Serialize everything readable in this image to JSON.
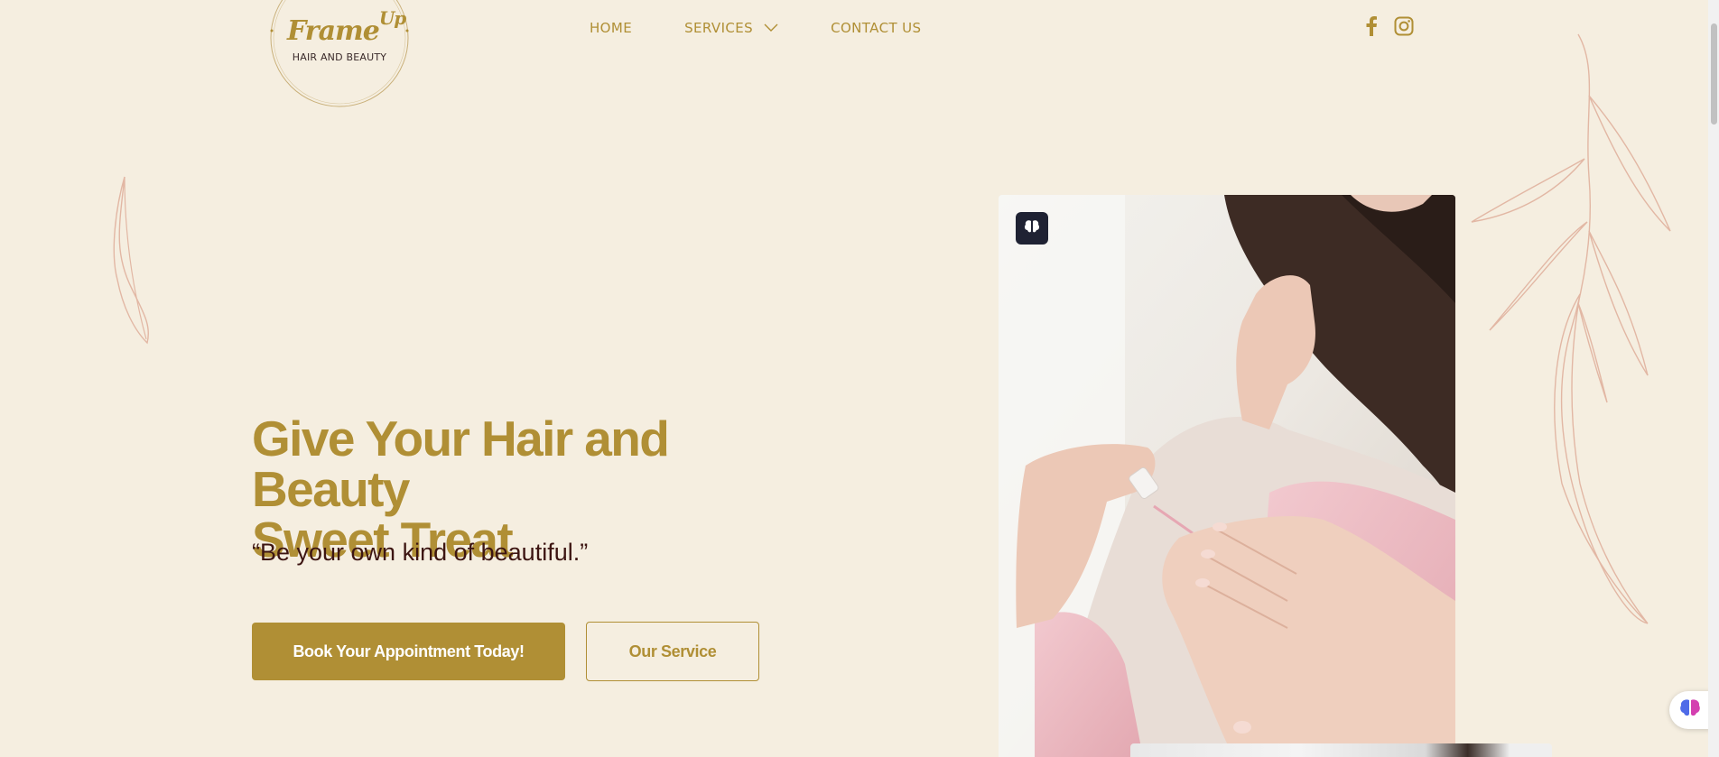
{
  "brand": {
    "logo_word": "Frame",
    "logo_sup": "Up",
    "logo_sub": "HAIR AND BEAUTY"
  },
  "nav": {
    "home": "HOME",
    "services": "SERVICES",
    "contact": "CONTACT US"
  },
  "social": {
    "facebook_icon": "facebook-icon",
    "instagram_icon": "instagram-icon"
  },
  "hero": {
    "title_line1": "Give Your Hair and Beauty",
    "title_line2": "Sweet Treat",
    "tagline": "“Be your own kind of beautiful.”",
    "primary_button": "Book Your Appointment Today!",
    "secondary_button": "Our Service"
  },
  "colors": {
    "background": "#f5eee0",
    "accent_gold": "#b08f35",
    "text_dark": "#3d1512",
    "leaf_line": "#e2b7a4"
  }
}
